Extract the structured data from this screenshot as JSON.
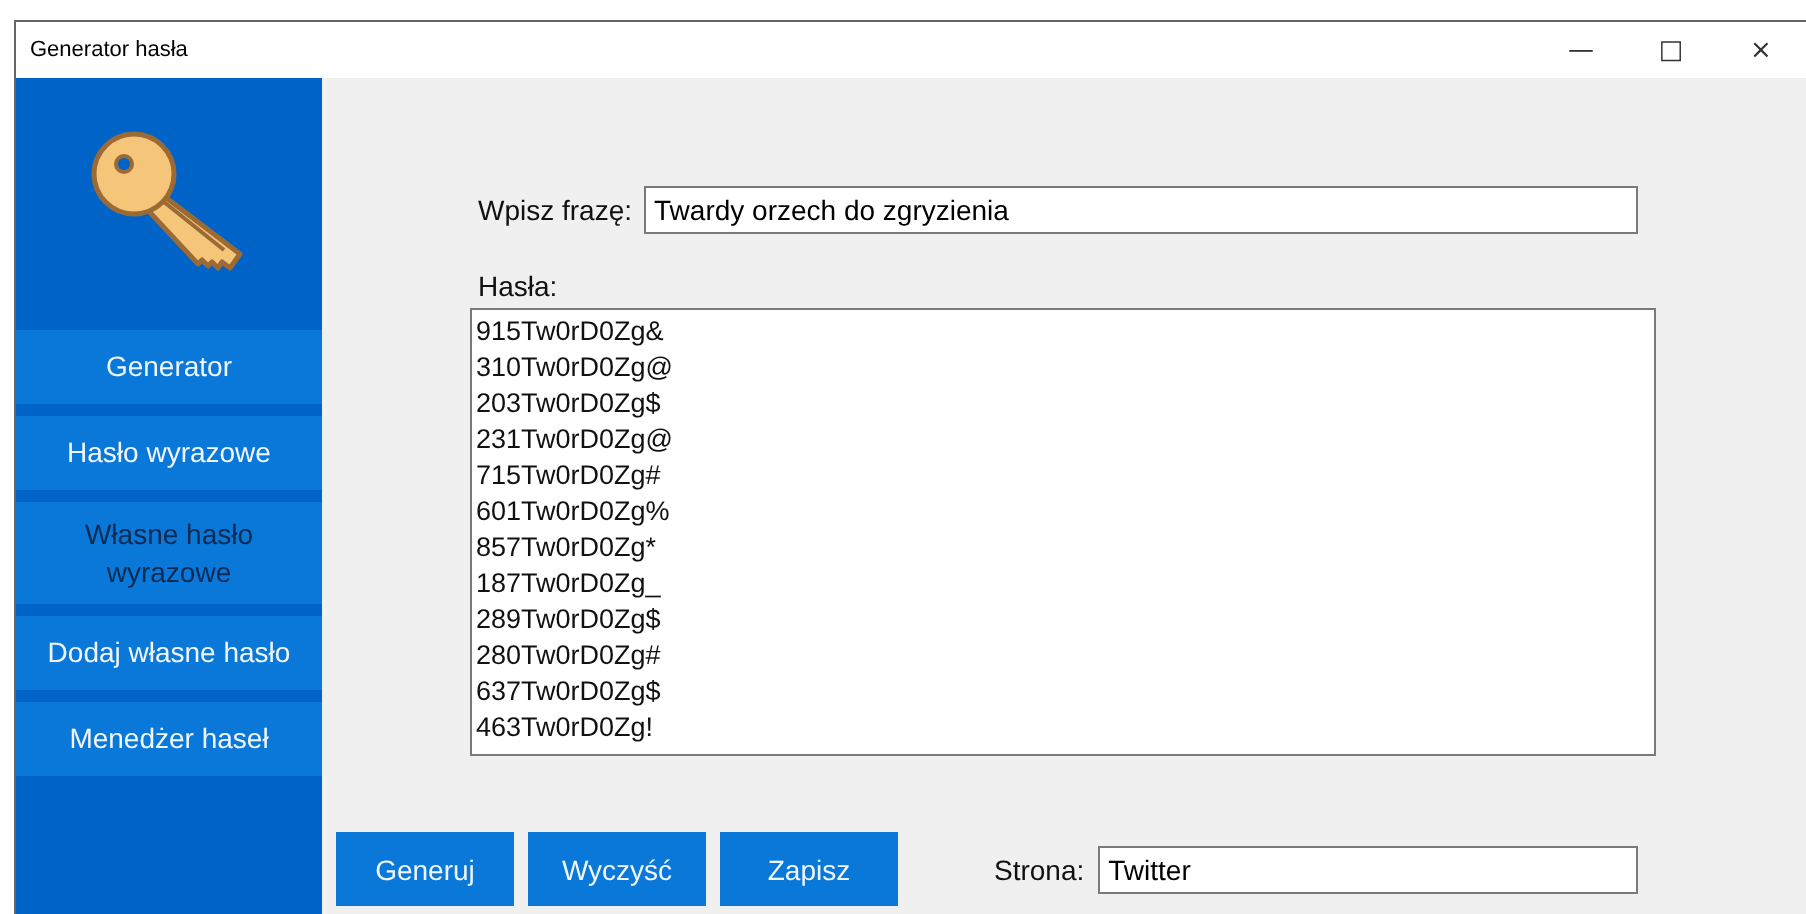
{
  "window": {
    "title": "Generator hasła",
    "controls": [
      "—",
      "□",
      "×"
    ]
  },
  "sidebar": {
    "items": [
      {
        "label": "Generator",
        "selected": false
      },
      {
        "label": "Hasło wyrazowe",
        "selected": false
      },
      {
        "label": "Własne hasło wyrazowe",
        "selected": true
      },
      {
        "label": "Dodaj własne hasło",
        "selected": false
      },
      {
        "label": "Menedżer haseł",
        "selected": false
      }
    ]
  },
  "phrase": {
    "label": "Wpisz frazę:",
    "value": "Twardy orzech do zgryzienia"
  },
  "passwords": {
    "label": "Hasła:",
    "items": [
      "915Tw0rD0Zg&",
      "310Tw0rD0Zg@",
      "203Tw0rD0Zg$",
      "231Tw0rD0Zg@",
      "715Tw0rD0Zg#",
      "601Tw0rD0Zg%",
      "857Tw0rD0Zg*",
      "187Tw0rD0Zg_",
      "289Tw0rD0Zg$",
      "280Tw0rD0Zg#",
      "637Tw0rD0Zg$",
      "463Tw0rD0Zg!"
    ]
  },
  "buttons": [
    "Generuj",
    "Wyczyść",
    "Zapisz"
  ],
  "site": {
    "label": "Strona:",
    "value": "Twitter"
  }
}
